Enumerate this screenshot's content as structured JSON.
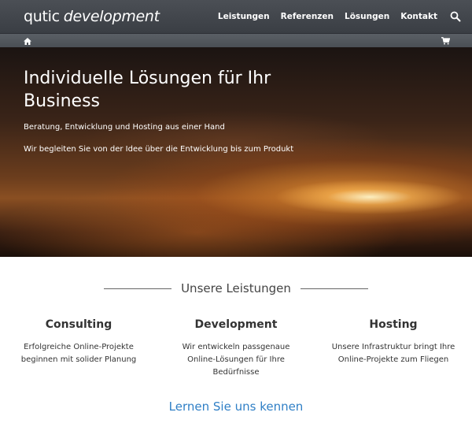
{
  "navbar": {
    "brand_bold": "qutic",
    "brand_italic": "development",
    "links": [
      "Leistungen",
      "Referenzen",
      "Lösungen",
      "Kontakt"
    ]
  },
  "icons": {
    "search": "search-icon",
    "home": "home-icon",
    "cart": "cart-icon"
  },
  "hero": {
    "title": "Individuelle Lösungen für Ihr Business",
    "subtitle1": "Beratung, Entwicklung und Hosting aus einer Hand",
    "subtitle2": "Wir begleiten Sie von der Idee über die Entwicklung bis zum Produkt"
  },
  "services": {
    "heading": "Unsere Leistungen",
    "items": [
      {
        "title": "Consulting",
        "text": "Erfolgreiche Online-Projekte beginnen mit solider Planung"
      },
      {
        "title": "Development",
        "text": "Wir entwickeln passgenaue Online-Lösungen für Ihre Bedürfnisse"
      },
      {
        "title": "Hosting",
        "text": "Unsere Infrastruktur bringt Ihre Online-Projekte zum Fliegen"
      }
    ],
    "cta": "Lernen Sie uns kennen"
  },
  "colors": {
    "navbar": "#3f4349",
    "link": "#2f7fc6"
  }
}
